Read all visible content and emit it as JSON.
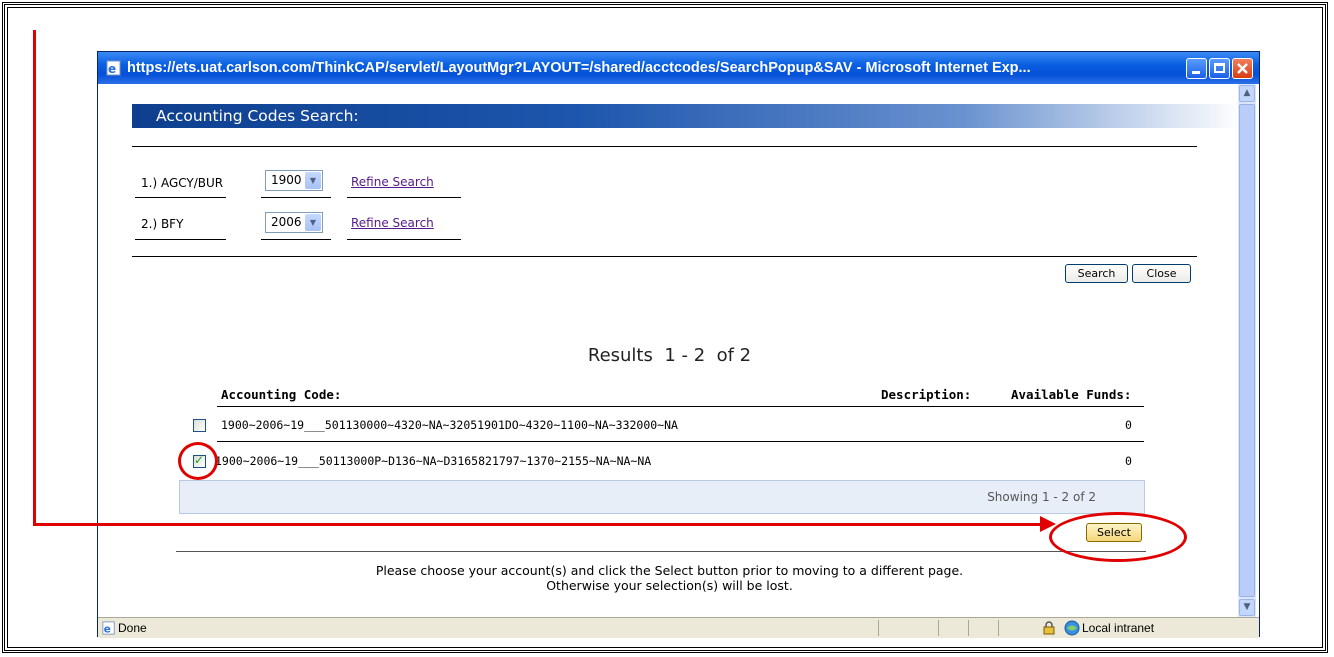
{
  "window": {
    "title": "https://ets.uat.carlson.com/ThinkCAP/servlet/LayoutMgr?LAYOUT=/shared/acctcodes/SearchPopup&SAV - Microsoft Internet Exp...",
    "minimize_icon": "minimize-icon",
    "maximize_icon": "maximize-icon",
    "close_icon": "close-icon"
  },
  "page": {
    "header": "Accounting Codes Search:",
    "criteria": [
      {
        "label": "1.) AGCY/BUR",
        "value": "1900",
        "link": "Refine Search"
      },
      {
        "label": "2.) BFY",
        "value": "2006",
        "link": "Refine Search"
      }
    ],
    "search_button": "Search",
    "close_button": "Close",
    "results_title": "Results  1 - 2  of 2",
    "columns": {
      "code": "Accounting Code:",
      "description": "Description:",
      "funds": "Available Funds:"
    },
    "rows": [
      {
        "code": "1900~2006~19___501130000~4320~NA~32051901DO~4320~1100~NA~332000~NA",
        "funds": "0",
        "checked": false
      },
      {
        "code": "1900~2006~19___50113000P~D136~NA~D3165821797~1370~2155~NA~NA~NA",
        "funds": "0",
        "checked": true
      }
    ],
    "showing": "Showing 1 - 2 of 2",
    "select_button": "Select",
    "footer_line1": "Please choose your account(s) and click the Select button prior to moving to a different page.",
    "footer_line2": "Otherwise your selection(s) will be lost."
  },
  "statusbar": {
    "status": "Done",
    "zone": "Local intranet"
  },
  "colors": {
    "annotation": "#e00000",
    "titlebar": "#0a5fe0",
    "header_band": "#0e3f8e"
  }
}
